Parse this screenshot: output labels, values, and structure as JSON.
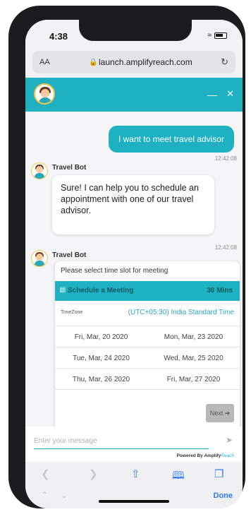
{
  "status_bar": {
    "time": "4:38"
  },
  "browser": {
    "text_size_label": "AA",
    "url": "launch.amplifyreach.com"
  },
  "chat": {
    "user_message": "I want to meet travel advisor",
    "user_timestamp": "12:42:08",
    "bot_name": "Travel Bot",
    "bot_message": "Sure! I can help you to schedule an appointment with one of our travel advisor.",
    "bot_timestamp": "12:42:08"
  },
  "scheduler": {
    "prompt": "Please select time slot for meeting",
    "title": "Schedule a Meeting",
    "duration": "30 Mins",
    "timezone_label": "TimeZone",
    "timezone_value": "(UTC+05:30) India Standard Time",
    "dates": [
      "Fri, Mar, 20 2020",
      "Mon, Mar, 23 2020",
      "Tue, Mar, 24 2020",
      "Wed, Mar, 25 2020",
      "Thu, Mar, 26 2020",
      "Fri, Mar, 27 2020"
    ],
    "next_label": "Next"
  },
  "input": {
    "placeholder": "Enter your message"
  },
  "powered_by": {
    "prefix": "Powered By Amplify",
    "brand": "Reach"
  },
  "toolbar": {
    "done_label": "Done"
  },
  "colors": {
    "accent": "#1fb1c1",
    "ios_blue": "#2f7bf5"
  },
  "icons": {
    "wifi": "wifi-icon",
    "battery": "battery-icon",
    "lock": "lock-icon",
    "reload": "reload-icon",
    "minimize": "minimize-icon",
    "close": "close-icon",
    "calendar": "calendar-icon",
    "next": "arrow-right-icon",
    "send": "send-icon",
    "share": "share-icon",
    "bookmarks": "book-icon",
    "tabs": "tabs-icon"
  }
}
